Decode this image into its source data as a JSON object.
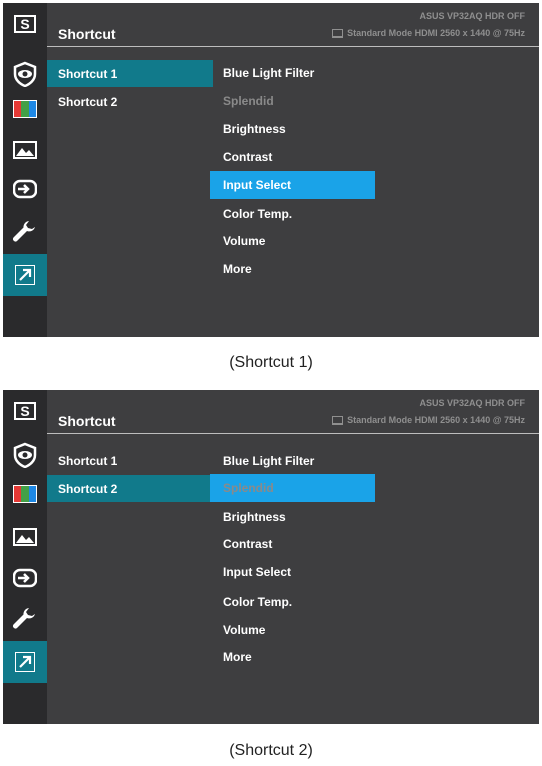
{
  "colors": {
    "osd_bg": "#3e3e40",
    "sidebar_bg": "#2a2a2c",
    "active_teal": "#117a8b",
    "highlight_blue": "#1aa3e8",
    "dim_text": "#8a8a8a"
  },
  "sidebar_icons": [
    "splendid-logo-icon",
    "eye-icon",
    "color-icon",
    "image-icon",
    "input-icon",
    "wrench-icon",
    "shortcut-arrow-icon"
  ],
  "screens": [
    {
      "title": "Shortcut",
      "model": "ASUS  VP32AQ  HDR OFF",
      "status": "Standard Mode HDMI 2560 x 1440 @ 75Hz",
      "level1": [
        "Shortcut 1",
        "Shortcut 2"
      ],
      "level2": [
        "Blue Light Filter",
        "Splendid",
        "Brightness",
        "Contrast",
        "Input Select",
        "Color Temp.",
        "Volume",
        "More"
      ],
      "caption": "(Shortcut 1)"
    },
    {
      "title": "Shortcut",
      "model": "ASUS  VP32AQ  HDR OFF",
      "status": "Standard Mode HDMI 2560 x 1440 @ 75Hz",
      "level1": [
        "Shortcut 1",
        "Shortcut 2"
      ],
      "level2": [
        "Blue Light Filter",
        "Splendid",
        "Brightness",
        "Contrast",
        "Input Select",
        "Color Temp.",
        "Volume",
        "More"
      ],
      "caption": "(Shortcut 2)"
    }
  ]
}
